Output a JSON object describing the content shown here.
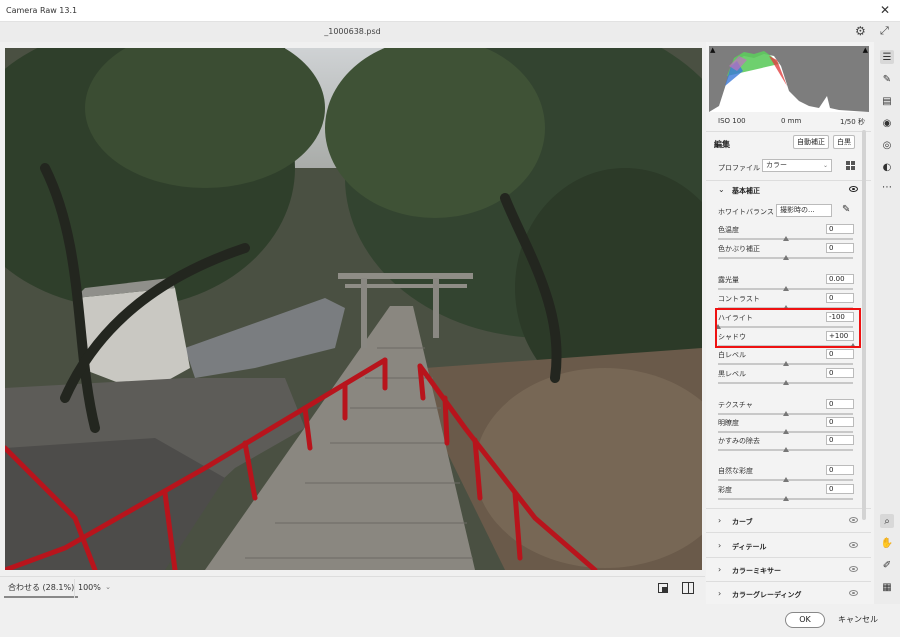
{
  "app": {
    "title": "Camera Raw 13.1",
    "filename": "_1000638.psd"
  },
  "bottom": {
    "zoom_fit": "合わせる (28.1%)",
    "zoom_100": "100%"
  },
  "metadata": {
    "iso": "ISO 100",
    "focal": "0 mm",
    "shutter": "1/50 秒"
  },
  "edit": {
    "label": "編集",
    "auto_button": "自動補正",
    "bw_button": "白黒"
  },
  "profile": {
    "label": "プロファイル",
    "value": "カラー"
  },
  "basic": {
    "title": "基本補正",
    "wb_label": "ホワイトバランス",
    "wb_value": "撮影時の...",
    "sliders": [
      {
        "label": "色温度",
        "value": "0",
        "level": 0.5
      },
      {
        "label": "色かぶり補正",
        "value": "0",
        "level": 0.5
      },
      {
        "label": "露光量",
        "value": "0.00",
        "level": 0.5
      },
      {
        "label": "コントラスト",
        "value": "0",
        "level": 0.5
      },
      {
        "label": "ハイライト",
        "value": "-100",
        "level": 0.0
      },
      {
        "label": "シャドウ",
        "value": "+100",
        "level": 1.0
      },
      {
        "label": "白レベル",
        "value": "0",
        "level": 0.5
      },
      {
        "label": "黒レベル",
        "value": "0",
        "level": 0.5
      },
      {
        "label": "テクスチャ",
        "value": "0",
        "level": 0.5
      },
      {
        "label": "明瞭度",
        "value": "0",
        "level": 0.5
      },
      {
        "label": "かすみの除去",
        "value": "0",
        "level": 0.5
      },
      {
        "label": "自然な彩度",
        "value": "0",
        "level": 0.5
      },
      {
        "label": "彩度",
        "value": "0",
        "level": 0.5
      }
    ]
  },
  "sections": {
    "curve": "カーブ",
    "detail": "ディテール",
    "mixer": "カラーミキサー",
    "grading": "カラーグレーディング"
  },
  "footer": {
    "ok": "OK",
    "cancel": "キャンセル"
  },
  "colors": {
    "highlight_box": "#e11111",
    "rail": "#b8141c"
  },
  "icons": {
    "right_toolbar": [
      "edit-sliders-icon",
      "brush-icon",
      "gradient-icon",
      "radial-icon",
      "redeye-icon",
      "mask-icon",
      "more-icon"
    ],
    "bottom_toolbar": [
      "zoom-icon",
      "hand-icon",
      "eyedropper-icon",
      "grid-icon"
    ]
  }
}
